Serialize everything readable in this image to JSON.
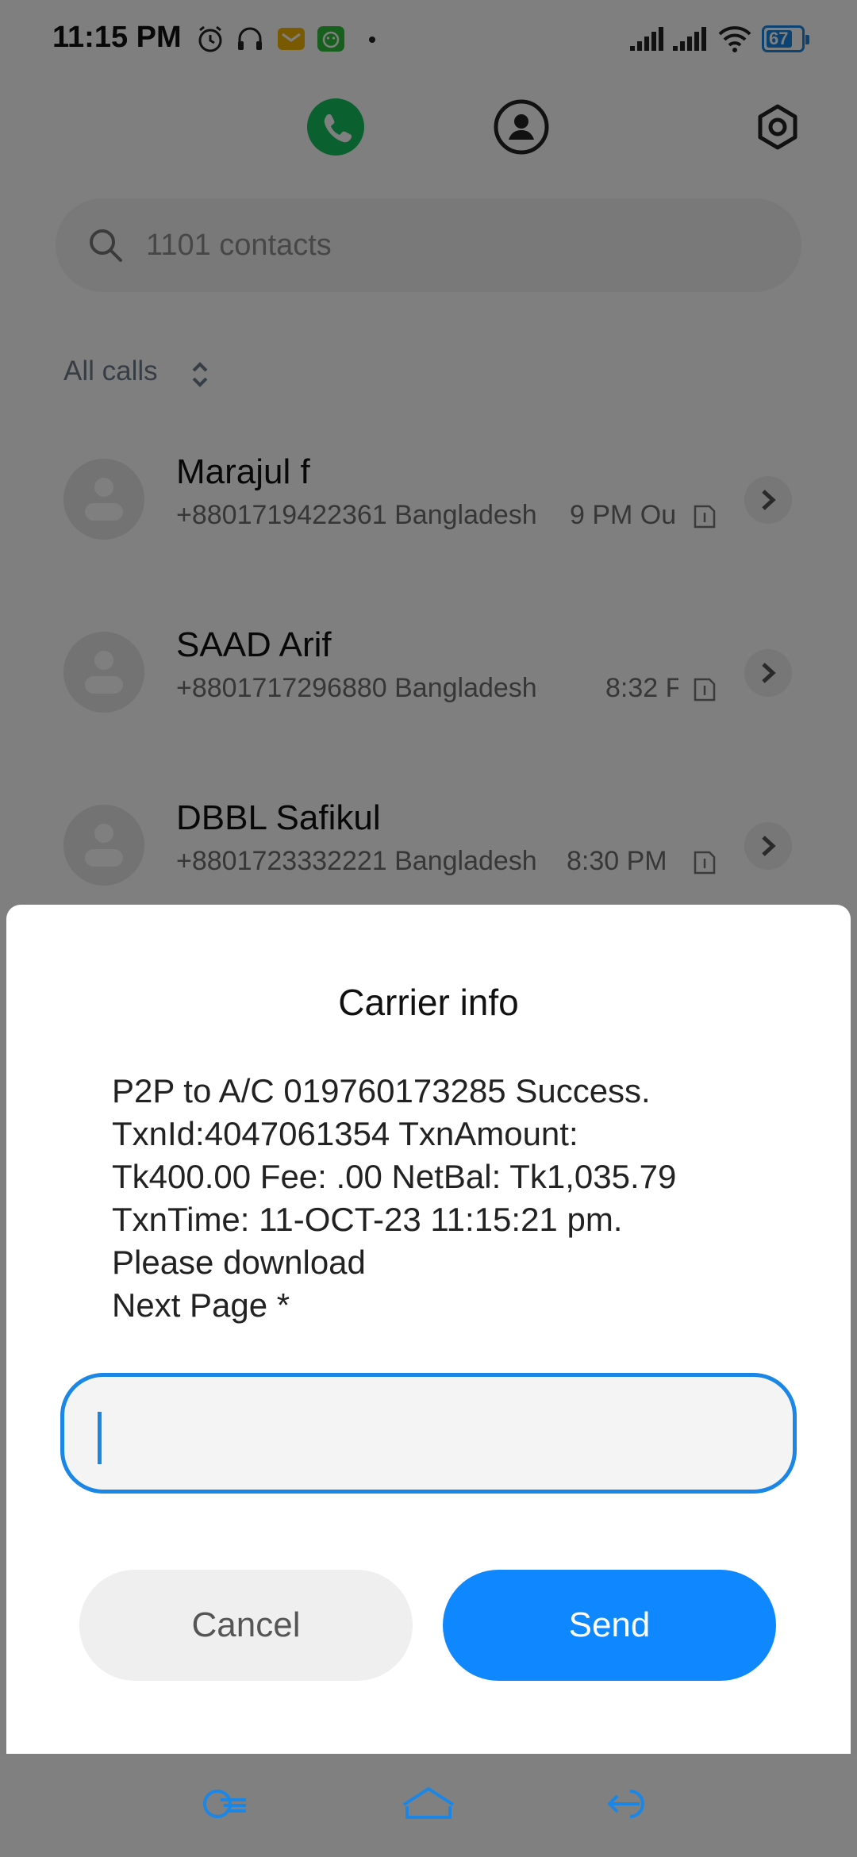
{
  "status_bar": {
    "time": "11:15 PM",
    "battery": "67"
  },
  "search": {
    "placeholder": "1101 contacts"
  },
  "filter": {
    "label": "All calls"
  },
  "calls": [
    {
      "name": "Marajul f",
      "number": "+8801719422361 Bangladesh",
      "time": "9 PM Ou"
    },
    {
      "name": "SAAD Arif",
      "number": "+8801717296880 Bangladesh",
      "time": "8:32 F"
    },
    {
      "name": "DBBL Safikul",
      "number": "+8801723332221 Bangladesh",
      "time": "8:30 PM"
    }
  ],
  "dialog": {
    "title": "Carrier info",
    "message": "P2P to A/C 019760173285 Success.\nTxnId:4047061354 TxnAmount:\nTk400.00 Fee: .00 NetBal: Tk1,035.79\nTxnTime: 11-OCT-23 11:15:21 pm.\nPlease download\nNext Page *",
    "input_value": "",
    "cancel_label": "Cancel",
    "send_label": "Send"
  },
  "colors": {
    "accent": "#0f87ff",
    "call_green": "#15c15d"
  },
  "icons": [
    "alarm-icon",
    "headset-icon",
    "mail-icon",
    "android-icon",
    "signal-icon",
    "wifi-icon",
    "battery-icon",
    "phone-icon",
    "contact-icon",
    "settings-icon",
    "search-icon",
    "sort-icon",
    "chevron-right-icon",
    "sim-icon",
    "recents-icon",
    "home-icon",
    "back-icon"
  ]
}
